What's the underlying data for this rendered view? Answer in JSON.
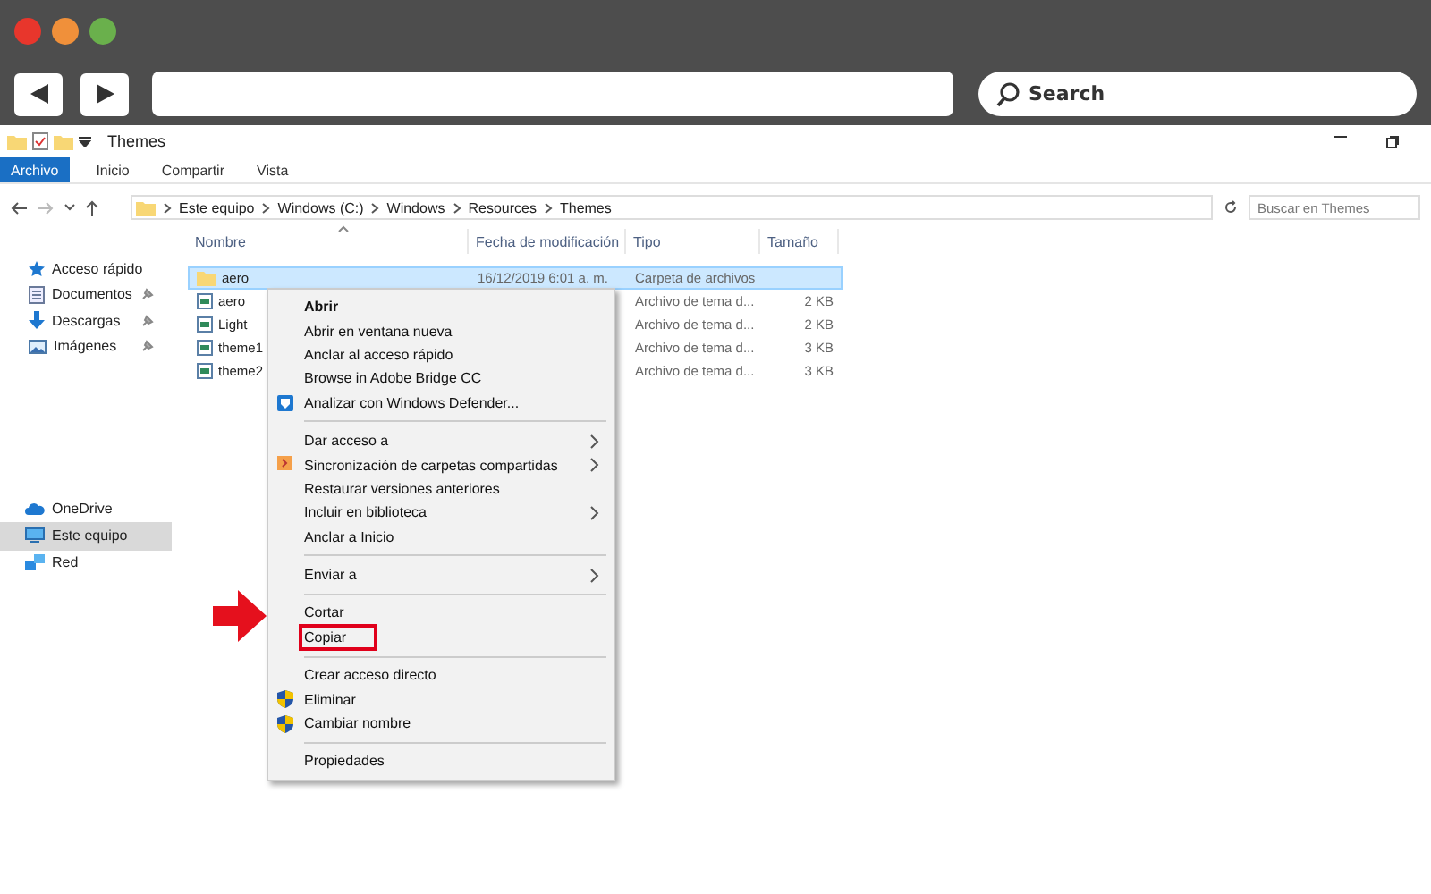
{
  "browser": {
    "search_placeholder": "Search"
  },
  "window": {
    "title": "Themes"
  },
  "ribbon_tabs": [
    {
      "label": "Archivo",
      "selected": true
    },
    {
      "label": "Inicio",
      "selected": false
    },
    {
      "label": "Compartir",
      "selected": false
    },
    {
      "label": "Vista",
      "selected": false
    }
  ],
  "address": {
    "crumbs": [
      "Este equipo",
      "Windows (C:)",
      "Windows",
      "Resources",
      "Themes"
    ],
    "search_placeholder": "Buscar en Themes"
  },
  "sidebar": {
    "items": [
      {
        "label": "Acceso rápido",
        "pinned": false,
        "selected": false
      },
      {
        "label": "Documentos",
        "pinned": true,
        "selected": false
      },
      {
        "label": "Descargas",
        "pinned": true,
        "selected": false
      },
      {
        "label": "Imágenes",
        "pinned": true,
        "selected": false
      },
      {
        "label": "OneDrive",
        "pinned": false,
        "selected": false
      },
      {
        "label": "Este equipo",
        "pinned": false,
        "selected": true
      },
      {
        "label": "Red",
        "pinned": false,
        "selected": false
      }
    ]
  },
  "table": {
    "columns": [
      "Nombre",
      "Fecha de modificación",
      "Tipo",
      "Tamaño"
    ],
    "rows": [
      {
        "kind": "folder",
        "name": "aero",
        "date": "16/12/2019 6:01 a. m.",
        "type": "Carpeta de archivos",
        "size": "",
        "selected": true
      },
      {
        "kind": "theme",
        "name": "aero",
        "date": "",
        "type": "Archivo de tema d...",
        "size": "2 KB",
        "selected": false
      },
      {
        "kind": "theme",
        "name": "Light",
        "date": "",
        "type": "Archivo de tema d...",
        "size": "2 KB",
        "selected": false
      },
      {
        "kind": "theme",
        "name": "theme1",
        "date": "",
        "type": "Archivo de tema d...",
        "size": "3 KB",
        "selected": false
      },
      {
        "kind": "theme",
        "name": "theme2",
        "date": "",
        "type": "Archivo de tema d...",
        "size": "3 KB",
        "selected": false
      }
    ]
  },
  "context_menu": {
    "items": [
      {
        "kind": "item",
        "label": "Abrir",
        "bold": true,
        "submenu": false,
        "highlighted": false
      },
      {
        "kind": "item",
        "label": "Abrir en ventana nueva",
        "bold": false,
        "submenu": false,
        "highlighted": false
      },
      {
        "kind": "item",
        "label": "Anclar al acceso rápido",
        "bold": false,
        "submenu": false,
        "highlighted": false
      },
      {
        "kind": "item",
        "label": "Browse in Adobe Bridge CC",
        "bold": false,
        "submenu": false,
        "highlighted": false
      },
      {
        "kind": "item",
        "label": "Analizar con Windows Defender...",
        "bold": false,
        "submenu": false,
        "highlighted": false
      },
      {
        "kind": "separator"
      },
      {
        "kind": "item",
        "label": "Dar acceso a",
        "bold": false,
        "submenu": true,
        "highlighted": false
      },
      {
        "kind": "item",
        "label": "Sincronización de carpetas compartidas",
        "bold": false,
        "submenu": true,
        "highlighted": false
      },
      {
        "kind": "item",
        "label": "Restaurar versiones anteriores",
        "bold": false,
        "submenu": false,
        "highlighted": false
      },
      {
        "kind": "item",
        "label": "Incluir en biblioteca",
        "bold": false,
        "submenu": true,
        "highlighted": false
      },
      {
        "kind": "item",
        "label": "Anclar a Inicio",
        "bold": false,
        "submenu": false,
        "highlighted": false
      },
      {
        "kind": "separator"
      },
      {
        "kind": "item",
        "label": "Enviar a",
        "bold": false,
        "submenu": true,
        "highlighted": false
      },
      {
        "kind": "separator"
      },
      {
        "kind": "item",
        "label": "Cortar",
        "bold": false,
        "submenu": false,
        "highlighted": false
      },
      {
        "kind": "item",
        "label": "Copiar",
        "bold": false,
        "submenu": false,
        "highlighted": true
      },
      {
        "kind": "separator"
      },
      {
        "kind": "item",
        "label": "Crear acceso directo",
        "bold": false,
        "submenu": false,
        "highlighted": false
      },
      {
        "kind": "item",
        "label": "Eliminar",
        "bold": false,
        "submenu": false,
        "highlighted": false
      },
      {
        "kind": "item",
        "label": "Cambiar nombre",
        "bold": false,
        "submenu": false,
        "highlighted": false
      },
      {
        "kind": "separator"
      },
      {
        "kind": "item",
        "label": "Propiedades",
        "bold": false,
        "submenu": false,
        "highlighted": false
      }
    ]
  }
}
